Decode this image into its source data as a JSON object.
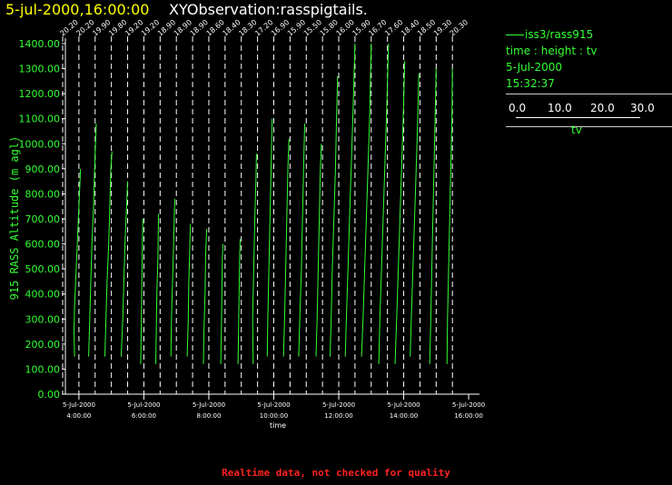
{
  "header": {
    "datetime": "5-jul-2000,16:00:00",
    "title": "XYObservation:rasspigtails."
  },
  "legend": {
    "series": "iss3/rass915",
    "params": "time : height : tv",
    "date": "5-Jul-2000",
    "time": "15:32:37",
    "scale_ticks": [
      "0.0",
      "10.0",
      "20.0",
      "30.0"
    ],
    "scale_label": "tv"
  },
  "warning": "Realtime data, not checked for quality",
  "colors": {
    "background": "#000000",
    "trace": "#33ff33",
    "axis_labels": "#33ff33",
    "tick_labels": "#ffffff",
    "datetime": "#ffff00",
    "warning": "#ff2222"
  },
  "chart_data": {
    "type": "line",
    "ylabel": "915 RASS Altitude (m agl)",
    "xlabel": "time",
    "ylim": [
      0,
      1400
    ],
    "y_ticks": [
      0,
      100,
      200,
      300,
      400,
      500,
      600,
      700,
      800,
      900,
      1000,
      1100,
      1200,
      1300,
      1400
    ],
    "y_tick_labels": [
      "0.00",
      "100.00",
      "200.00",
      "300.00",
      "400.00",
      "500.00",
      "600.00",
      "700.00",
      "800.00",
      "900.00",
      "1000.00",
      "1100.00",
      "1200.00",
      "1300.00",
      "1400.00"
    ],
    "xlim": [
      "2000-07-05 03:35",
      "2000-07-05 16:20"
    ],
    "x_ticks": [
      "2000-07-05 04:00",
      "2000-07-05 06:00",
      "2000-07-05 08:00",
      "2000-07-05 10:00",
      "2000-07-05 12:00",
      "2000-07-05 14:00",
      "2000-07-05 16:00"
    ],
    "x_tick_labels": [
      [
        "5-Jul-2000",
        "4:00:00"
      ],
      [
        "5-Jul-2000",
        "6:00:00"
      ],
      [
        "5-Jul-2000",
        "8:00:00"
      ],
      [
        "5-Jul-2000",
        "10:00:00"
      ],
      [
        "5-Jul-2000",
        "12:00:00"
      ],
      [
        "5-Jul-2000",
        "14:00:00"
      ],
      [
        "5-Jul-2000",
        "16:00:00"
      ]
    ],
    "profiles": [
      {
        "time": "2000-07-05 03:30",
        "label": "20.20",
        "heights": [
          100,
          200,
          300,
          400,
          500,
          600,
          700,
          800,
          900
        ],
        "offsets_min": [
          0,
          -1,
          -1,
          -1,
          0,
          1,
          1,
          2,
          3
        ]
      },
      {
        "time": "2000-07-05 04:00",
        "label": "20.20",
        "heights": [
          150,
          250,
          350,
          450,
          550,
          650,
          750,
          850,
          900
        ],
        "offsets_min": [
          -8,
          -9,
          -8,
          -6,
          -4,
          -2,
          0,
          2,
          3
        ]
      },
      {
        "time": "2000-07-05 04:30",
        "label": "19.90",
        "heights": [
          150,
          300,
          450,
          600,
          750,
          900,
          1080
        ],
        "offsets_min": [
          -12,
          -10,
          -8,
          -6,
          -3,
          -1,
          2
        ]
      },
      {
        "time": "2000-07-05 05:00",
        "label": "19.80",
        "heights": [
          150,
          300,
          450,
          600,
          750,
          900,
          970
        ],
        "offsets_min": [
          -12,
          -10,
          -8,
          -5,
          -3,
          -1,
          1
        ]
      },
      {
        "time": "2000-07-05 05:30",
        "label": "19.20",
        "heights": [
          150,
          300,
          450,
          600,
          750,
          850
        ],
        "offsets_min": [
          -12,
          -9,
          -7,
          -5,
          -2,
          0
        ]
      },
      {
        "time": "2000-07-05 06:00",
        "label": "19.20",
        "heights": [
          120,
          250,
          400,
          550,
          700
        ],
        "offsets_min": [
          -6,
          -5,
          -4,
          -3,
          -2
        ]
      },
      {
        "time": "2000-07-05 06:30",
        "label": "18.90",
        "heights": [
          120,
          250,
          400,
          550,
          720
        ],
        "offsets_min": [
          -8,
          -7,
          -6,
          -4,
          -3
        ]
      },
      {
        "time": "2000-07-05 07:00",
        "label": "18.90",
        "heights": [
          150,
          300,
          450,
          600,
          780
        ],
        "offsets_min": [
          -10,
          -9,
          -7,
          -5,
          -3
        ]
      },
      {
        "time": "2000-07-05 07:30",
        "label": "18.90",
        "heights": [
          150,
          300,
          450,
          600,
          680
        ],
        "offsets_min": [
          -10,
          -8,
          -7,
          -5,
          -4
        ]
      },
      {
        "time": "2000-07-05 08:00",
        "label": "18.60",
        "heights": [
          120,
          250,
          400,
          550,
          660
        ],
        "offsets_min": [
          -10,
          -9,
          -7,
          -6,
          -4
        ]
      },
      {
        "time": "2000-07-05 08:30",
        "label": "18.40",
        "heights": [
          120,
          250,
          400,
          550,
          600
        ],
        "offsets_min": [
          -8,
          -7,
          -6,
          -5,
          -4
        ]
      },
      {
        "time": "2000-07-05 09:00",
        "label": "18.30",
        "heights": [
          120,
          250,
          400,
          550,
          620
        ],
        "offsets_min": [
          -6,
          -5,
          -4,
          -3,
          -2
        ]
      },
      {
        "time": "2000-07-05 09:30",
        "label": "17.20",
        "heights": [
          120,
          300,
          500,
          700,
          850,
          960
        ],
        "offsets_min": [
          -8,
          -9,
          -7,
          -5,
          -3,
          -2
        ]
      },
      {
        "time": "2000-07-05 10:00",
        "label": "16.90",
        "heights": [
          150,
          300,
          500,
          700,
          900,
          1100
        ],
        "offsets_min": [
          -12,
          -11,
          -9,
          -7,
          -5,
          -3
        ]
      },
      {
        "time": "2000-07-05 10:30",
        "label": "15.90",
        "heights": [
          150,
          300,
          500,
          700,
          900,
          1020
        ],
        "offsets_min": [
          -12,
          -10,
          -8,
          -6,
          -4,
          -2
        ]
      },
      {
        "time": "2000-07-05 11:00",
        "label": "15.50",
        "heights": [
          150,
          300,
          500,
          700,
          900,
          1080
        ],
        "offsets_min": [
          -14,
          -12,
          -9,
          -7,
          -5,
          -3
        ]
      },
      {
        "time": "2000-07-05 11:30",
        "label": "15.80",
        "heights": [
          150,
          300,
          500,
          700,
          900,
          1000
        ],
        "offsets_min": [
          -12,
          -10,
          -8,
          -6,
          -4,
          -2
        ]
      },
      {
        "time": "2000-07-05 12:00",
        "label": "16.00",
        "heights": [
          150,
          300,
          500,
          700,
          900,
          1100,
          1270
        ],
        "offsets_min": [
          -16,
          -14,
          -12,
          -9,
          -6,
          -4,
          -2
        ]
      },
      {
        "time": "2000-07-05 12:30",
        "label": "15.90",
        "heights": [
          150,
          300,
          500,
          700,
          900,
          1100,
          1400
        ],
        "offsets_min": [
          -18,
          -16,
          -13,
          -10,
          -7,
          -4,
          0
        ]
      },
      {
        "time": "2000-07-05 13:00",
        "label": "16.70",
        "heights": [
          150,
          300,
          500,
          700,
          900,
          1100,
          1400
        ],
        "offsets_min": [
          -18,
          -15,
          -12,
          -9,
          -6,
          -3,
          0
        ]
      },
      {
        "time": "2000-07-05 13:30",
        "label": "17.60",
        "heights": [
          120,
          300,
          500,
          700,
          900,
          1100,
          1400
        ],
        "offsets_min": [
          -16,
          -14,
          -11,
          -8,
          -5,
          -2,
          2
        ]
      },
      {
        "time": "2000-07-05 14:00",
        "label": "18.40",
        "heights": [
          120,
          300,
          500,
          700,
          900,
          1100,
          1330
        ],
        "offsets_min": [
          -16,
          -13,
          -10,
          -7,
          -4,
          -1,
          2
        ]
      },
      {
        "time": "2000-07-05 14:30",
        "label": "18.50",
        "heights": [
          150,
          300,
          500,
          700,
          900,
          1100,
          1280
        ],
        "offsets_min": [
          -18,
          -16,
          -13,
          -10,
          -7,
          -4,
          -2
        ]
      },
      {
        "time": "2000-07-05 15:00",
        "label": "19.30",
        "heights": [
          120,
          300,
          500,
          700,
          900,
          1100,
          1300
        ],
        "offsets_min": [
          -12,
          -10,
          -8,
          -6,
          -4,
          -2,
          0
        ]
      },
      {
        "time": "2000-07-05 15:30",
        "label": "20.30",
        "heights": [
          120,
          300,
          500,
          700,
          900,
          1100,
          1300
        ],
        "offsets_min": [
          -10,
          -9,
          -7,
          -5,
          -3,
          -1,
          0
        ]
      }
    ]
  }
}
